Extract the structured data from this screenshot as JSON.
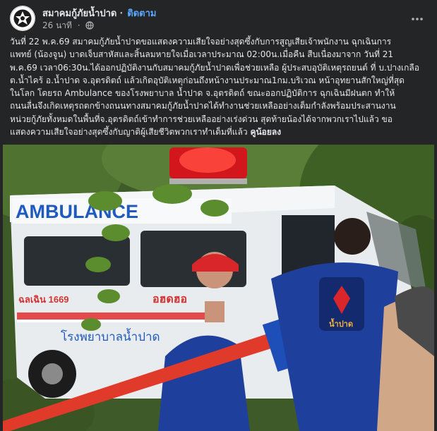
{
  "post": {
    "page_name": "สมาคมกู้ภัยน้ำปาด",
    "separator": "·",
    "follow_label": "ติดตาม",
    "time_ago": "26 นาที",
    "privacy_icon": "globe-icon",
    "more_icon": "more-horizontal-icon",
    "text_lines": [
      "วันที่ 22 พ.ค.69 สมาคมกู้ภัยน้ำปาดขอแสดงความเสียใจอย่างสุดซึ้งกับการสูญเสียเจ้าพนักงาน ฉุกเฉินการ",
      "แพทย์ (น้องจูน) บาดเจ็บสาหัสและสิ้นลมหายใจเมื่อเวลาประมาณ 02:00น.เมื่อคืน สืบเนื่องมาจาก วันที่ 21",
      "พ.ค.69 เวลา06:30น.ได้ออกปฏิบัติงานกับสมาคมกู้ภัยน้ำปาดเพื่อช่วยเหลือ ผู้ประสบอุบัติเหตุรถยนต์ ที่ บ.ปางเกลือ",
      "ต.น้ำไคร้ อ.น้ำปาด จ.อุตรดิตถ์ แล้วเกิดอุบัติเหตุก่อนถึงหน้างานประมาณ1กม.บริเวณ หน้าอุทยานสักใหญ่ที่สุด",
      "ในโลก โดยรถ Ambulance ของโรงพยาบาล น้ำปาด จ.อุตรดิตถ์ ขณะออกปฏิบัติการ ฉุกเฉินมีฝนตก ทำให้",
      "ถนนลื่นจึงเกิดเหตุรถตกข้างถนนทางสมาคมกู้ภัยน้ำปาดได้ทำงานช่วยเหลืออย่างเต็มกำลังพร้อมประสานงาน",
      "หน่วยกู้ภัยทั้งหมดในพื้นที่จ.อุตรดิตถ์เข้าทำการช่วยเหลืออย่างเร่งด่วน สุดท้ายน้องได้จากพวกเราไปแล้ว ขอ",
      "แสดงความเสียใจอย่างสุดซึ้งกับญาติผู้เสียชีวิตพวกเราทำเต็มที่แล้ว"
    ],
    "signature": "คูน้อยลง"
  },
  "photo": {
    "ambulance_text": "AMBULANCE",
    "hospital_text": "โรงพยาบาลน้ำปาด",
    "unit_code": "ฉลเฉิน 1669",
    "red_label": "อฮดฮอ",
    "rescuer_badge_text": "น้ำปาด",
    "colors": {
      "uniform": "#1f3f9c",
      "helmet": "#d8262b",
      "stretcher": "#e03a2a",
      "foliage": "#4c6b2e",
      "ambulance": "#eceff1"
    }
  }
}
